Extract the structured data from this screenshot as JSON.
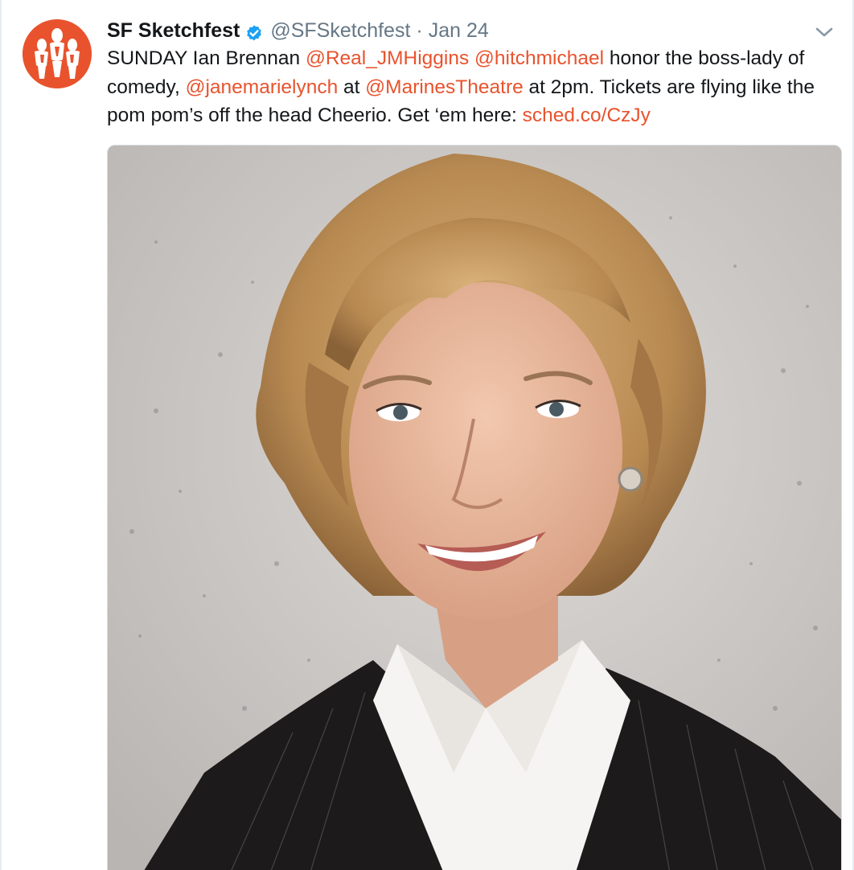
{
  "tweet": {
    "author_name": "SF Sketchfest",
    "handle": "@SFSketchfest",
    "separator": "·",
    "date": "Jan 24",
    "text": {
      "line1": {
        "t1": "SUNDAY Ian Brennan ",
        "m1": "@Real_JMHiggins",
        "t2": " ",
        "m2": "@hitchmichael",
        "t3": " honor the boss-lady of"
      },
      "line2": {
        "t1": "comedy, ",
        "m1": "@janemarielynch",
        "t2": " at ",
        "m2": "@MarinesTheatre",
        "t3": " at 2pm. Tickets are flying like the"
      },
      "line3": {
        "t1": "pom pom’s off the head Cheerio. Get ‘em here: ",
        "link": "sched.co/CzJy"
      }
    }
  },
  "icons": {
    "avatar": "sf-sketchfest-logo",
    "verified": "verified-badge-icon",
    "menu": "chevron-down-icon"
  },
  "colors": {
    "accent": "#e8532d",
    "verified": "#1da1f2",
    "muted": "#657786"
  }
}
